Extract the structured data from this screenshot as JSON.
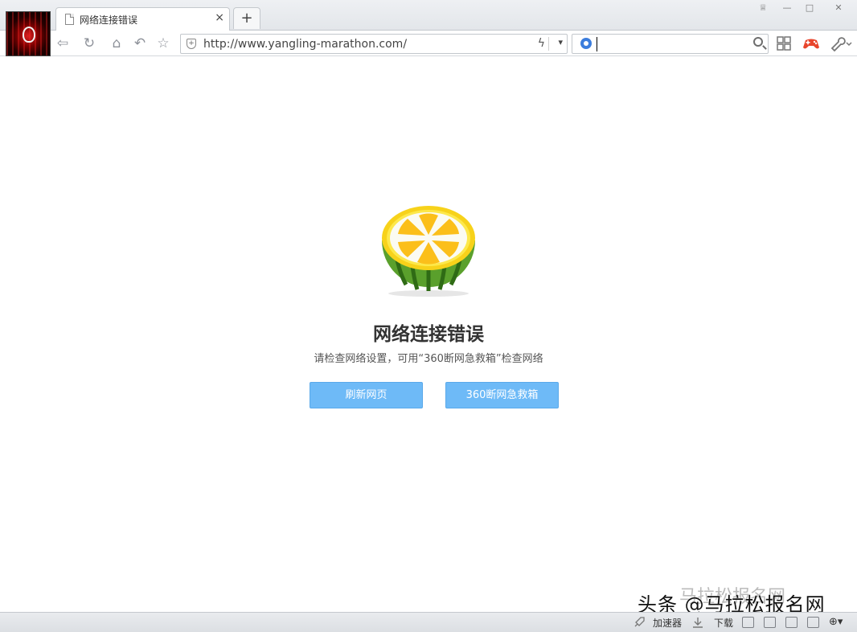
{
  "window": {
    "controls": {
      "skin": "♕",
      "minimize": "—",
      "maximize": "□",
      "close": "✕"
    }
  },
  "tab": {
    "title": "网络连接错误",
    "close": "×",
    "new_tab": "+"
  },
  "toolbar": {
    "back": "⇦",
    "refresh": "↻",
    "home": "⌂",
    "undo": "↶",
    "favorite": "☆",
    "url": "http://www.yangling-marathon.com/",
    "bolt": "ϟ",
    "dropdown": "▾",
    "search_value": ""
  },
  "error_page": {
    "title": "网络连接错误",
    "description": "请检查网络设置，可用“360断网急救箱”检查网络",
    "refresh_button": "刷新网页",
    "firstaid_button": "360断网急救箱"
  },
  "watermark": {
    "text": "头条 @马拉松报名网",
    "ghost": "马拉松报名网"
  },
  "statusbar": {
    "accelerator": "加速器",
    "download": "下载",
    "zoom": "⊕▾"
  },
  "colors": {
    "button": "#6ebaf7",
    "accent": "#3b7ddd",
    "game_icon": "#e8452c"
  }
}
